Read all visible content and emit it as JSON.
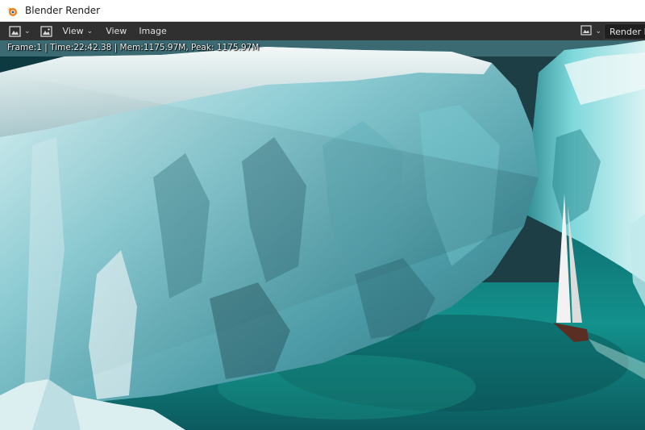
{
  "window": {
    "title": "Blender Render",
    "app_icon": "blender-logo-icon"
  },
  "toolbar": {
    "editor_type_icon": "image-editor-icon",
    "view_icon": "image-icon",
    "menu_view_dropdown": "View",
    "menu_view": "View",
    "menu_image": "Image",
    "slot_icon": "image-slot-icon",
    "render_slot_label": "Render R"
  },
  "viewport": {
    "stats_text": "Frame:1 | Time:22:42.38 | Mem:1175.97M, Peak: 1175.97M",
    "render_content": "iceberg-cliffs-with-sailboat"
  },
  "colors": {
    "header_bg": "#303030",
    "titlebar_bg": "#ffffff",
    "water": "#1a8f8a",
    "ice": "#9fd8dc"
  }
}
